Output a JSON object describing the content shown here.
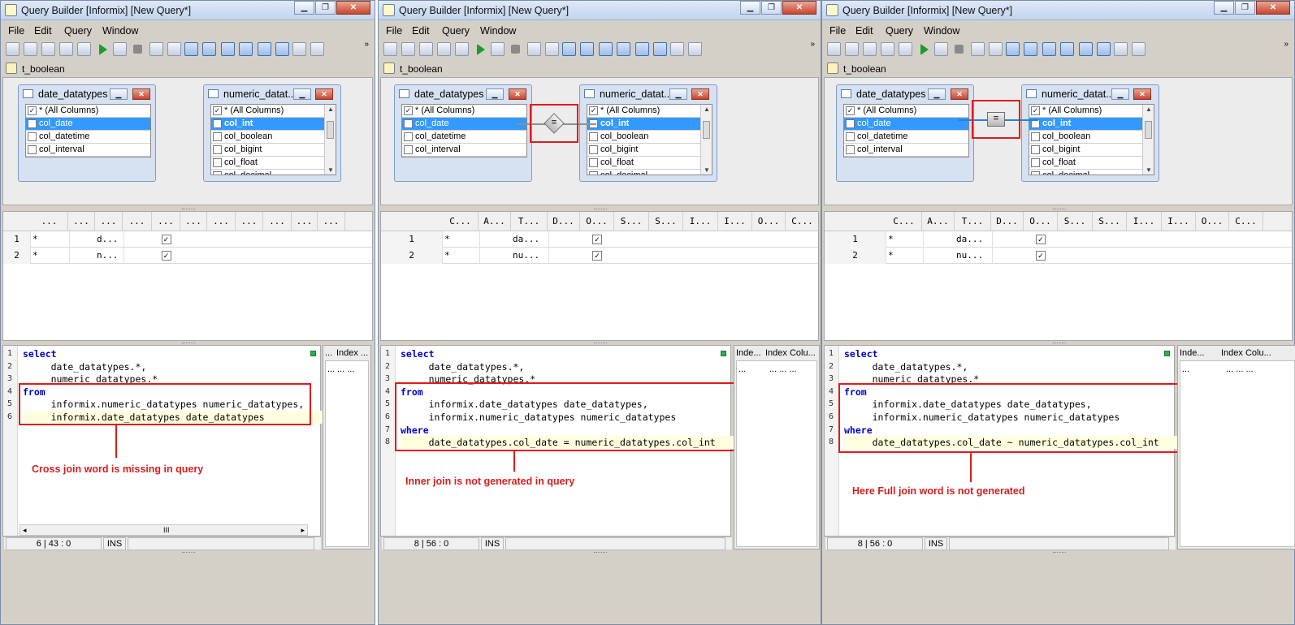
{
  "windows": [
    {
      "title": "Query Builder [Informix] [New Query*]",
      "menu": [
        "File",
        "Edit",
        "Query",
        "Window"
      ],
      "toolbar_overflow": "»",
      "context": "t_boolean",
      "left_table": {
        "name": "date_datatypes",
        "columns": [
          {
            "name": "* (All Columns)",
            "checked": true,
            "selected": false
          },
          {
            "name": "col_date",
            "checked": false,
            "selected": true
          },
          {
            "name": "col_datetime",
            "checked": false,
            "selected": false
          },
          {
            "name": "col_interval",
            "checked": false,
            "selected": false
          }
        ]
      },
      "right_table": {
        "name": "numeric_datat...",
        "columns": [
          {
            "name": "* (All Columns)",
            "checked": true,
            "selected": false
          },
          {
            "name": "col_int",
            "checked": false,
            "selected": true
          },
          {
            "name": "col_boolean",
            "checked": false,
            "selected": false
          },
          {
            "name": "col_bigint",
            "checked": false,
            "selected": false
          },
          {
            "name": "col_float",
            "checked": false,
            "selected": false
          },
          {
            "name": "col_decimal",
            "checked": false,
            "selected": false
          }
        ]
      },
      "join": null,
      "grid_headers": [
        "...",
        "...",
        "...",
        "...",
        "...",
        "...",
        "...",
        "...",
        "...",
        "...",
        "..."
      ],
      "grid_rows": [
        {
          "num": "1",
          "c1": "*",
          "c2": "d...",
          "checked": true
        },
        {
          "num": "2",
          "c1": "*",
          "c2": "n...",
          "checked": true
        }
      ],
      "code": [
        {
          "n": "1",
          "text": "select",
          "kw": true
        },
        {
          "n": "2",
          "text": "     date_datatypes.*,",
          "kw": false
        },
        {
          "n": "3",
          "text": "     numeric_datatypes.*",
          "kw": false
        },
        {
          "n": "4",
          "text": "from",
          "kw": true
        },
        {
          "n": "5",
          "text": "     informix.numeric_datatypes numeric_datatypes,",
          "kw": false
        },
        {
          "n": "6",
          "text": "     informix.date_datatypes date_datatypes",
          "kw": false,
          "hl": true
        }
      ],
      "annotation": "Cross join word is missing in query",
      "side_tabs": [
        "...",
        "Index ..."
      ],
      "side_cells": [
        "...",
        "... ..."
      ],
      "status_pos": "6 | 43 : 0",
      "status_mode": "INS",
      "hscroll_mid": "III"
    },
    {
      "title": "Query Builder [Informix] [New Query*]",
      "menu": [
        "File",
        "Edit",
        "Query",
        "Window"
      ],
      "toolbar_overflow": "»",
      "context": "t_boolean",
      "left_table": {
        "name": "date_datatypes",
        "columns": [
          {
            "name": "* (All Columns)",
            "checked": true,
            "selected": false
          },
          {
            "name": "col_date",
            "checked": false,
            "selected": true
          },
          {
            "name": "col_datetime",
            "checked": false,
            "selected": false
          },
          {
            "name": "col_interval",
            "checked": false,
            "selected": false
          }
        ]
      },
      "right_table": {
        "name": "numeric_datat...",
        "columns": [
          {
            "name": "* (All Columns)",
            "checked": true,
            "selected": false
          },
          {
            "name": "col_int",
            "checked": false,
            "selected": true
          },
          {
            "name": "col_boolean",
            "checked": false,
            "selected": false
          },
          {
            "name": "col_bigint",
            "checked": false,
            "selected": false
          },
          {
            "name": "col_float",
            "checked": false,
            "selected": false
          },
          {
            "name": "col_decimal",
            "checked": false,
            "selected": false
          }
        ]
      },
      "join": {
        "symbol": "=",
        "style": "diamond",
        "line_color": "#909090"
      },
      "grid_headers": [
        "C...",
        "A...",
        "T...",
        "D...",
        "O...",
        "S...",
        "S...",
        "I...",
        "I...",
        "O...",
        "C..."
      ],
      "grid_rows": [
        {
          "num": "1",
          "c1": "*",
          "c2": "da...",
          "checked": true
        },
        {
          "num": "2",
          "c1": "*",
          "c2": "nu...",
          "checked": true
        }
      ],
      "code": [
        {
          "n": "1",
          "text": "select",
          "kw": true
        },
        {
          "n": "2",
          "text": "     date_datatypes.*,",
          "kw": false
        },
        {
          "n": "3",
          "text": "     numeric_datatypes.*",
          "kw": false
        },
        {
          "n": "4",
          "text": "from",
          "kw": true
        },
        {
          "n": "5",
          "text": "     informix.date_datatypes date_datatypes,",
          "kw": false
        },
        {
          "n": "6",
          "text": "     informix.numeric_datatypes numeric_datatypes",
          "kw": false
        },
        {
          "n": "7",
          "text": "where",
          "kw": true
        },
        {
          "n": "8",
          "text": "     date_datatypes.col_date = numeric_datatypes.col_int",
          "kw": false,
          "hl": true
        }
      ],
      "annotation": "Inner join is not generated in query",
      "side_tabs": [
        "Inde...",
        "Index Colu..."
      ],
      "side_cells": [
        "...",
        "... ... ..."
      ],
      "status_pos": "8 | 56 : 0",
      "status_mode": "INS",
      "hscroll_mid": ""
    },
    {
      "title": "Query Builder [Informix] [New Query*]",
      "menu": [
        "File",
        "Edit",
        "Query",
        "Window"
      ],
      "toolbar_overflow": "»",
      "context": "t_boolean",
      "left_table": {
        "name": "date_datatypes",
        "columns": [
          {
            "name": "* (All Columns)",
            "checked": true,
            "selected": false
          },
          {
            "name": "col_date",
            "checked": false,
            "selected": true
          },
          {
            "name": "col_datetime",
            "checked": false,
            "selected": false
          },
          {
            "name": "col_interval",
            "checked": false,
            "selected": false
          }
        ]
      },
      "right_table": {
        "name": "numeric_datat...",
        "columns": [
          {
            "name": "* (All Columns)",
            "checked": true,
            "selected": false
          },
          {
            "name": "col_int",
            "checked": false,
            "selected": true
          },
          {
            "name": "col_boolean",
            "checked": false,
            "selected": false
          },
          {
            "name": "col_bigint",
            "checked": false,
            "selected": false
          },
          {
            "name": "col_float",
            "checked": false,
            "selected": false
          },
          {
            "name": "col_decimal",
            "checked": false,
            "selected": false
          }
        ]
      },
      "join": {
        "symbol": "=",
        "style": "square",
        "line_color": "#2a7fd6"
      },
      "grid_headers": [
        "C...",
        "A...",
        "T...",
        "D...",
        "O...",
        "S...",
        "S...",
        "I...",
        "I...",
        "O...",
        "C..."
      ],
      "grid_rows": [
        {
          "num": "1",
          "c1": "*",
          "c2": "da...",
          "checked": true
        },
        {
          "num": "2",
          "c1": "*",
          "c2": "nu...",
          "checked": true
        }
      ],
      "code": [
        {
          "n": "1",
          "text": "select",
          "kw": true
        },
        {
          "n": "2",
          "text": "     date_datatypes.*,",
          "kw": false
        },
        {
          "n": "3",
          "text": "     numeric_datatypes.*",
          "kw": false
        },
        {
          "n": "4",
          "text": "from",
          "kw": true
        },
        {
          "n": "5",
          "text": "     informix.date_datatypes date_datatypes,",
          "kw": false
        },
        {
          "n": "6",
          "text": "     informix.numeric_datatypes numeric_datatypes",
          "kw": false
        },
        {
          "n": "7",
          "text": "where",
          "kw": true
        },
        {
          "n": "8",
          "text": "     date_datatypes.col_date ~ numeric_datatypes.col_int",
          "kw": false,
          "hl": true
        }
      ],
      "annotation": "Here Full join word is not generated",
      "side_tabs": [
        "Inde...",
        "Index Colu..."
      ],
      "side_cells": [
        "...",
        "... ... ..."
      ],
      "status_pos": "8 | 56 : 0",
      "status_mode": "INS",
      "hscroll_mid": ""
    }
  ]
}
